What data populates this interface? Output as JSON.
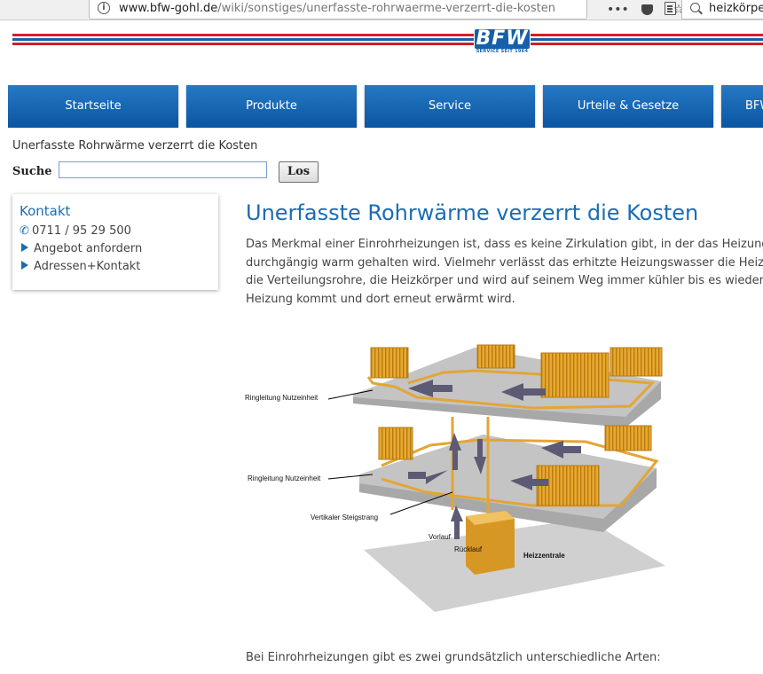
{
  "browser": {
    "url_domain": "www.bfw-gohl.de",
    "url_path": "/wiki/sonstiges/unerfasste-rohrwaerme-verzerrt-die-kosten",
    "search_text": "heizkörper",
    "more_glyph": "•••",
    "bookmark_glyph": "☆"
  },
  "header": {
    "logo_text": "BFW",
    "logo_sub": "SERVICE SEIT 1964",
    "stripe_colors": [
      "#1560ab",
      "#d0202a"
    ]
  },
  "nav": [
    {
      "label": "Startseite"
    },
    {
      "label": "Produkte"
    },
    {
      "label": "Service"
    },
    {
      "label": "Urteile & Gesetze"
    },
    {
      "label": "BFW"
    }
  ],
  "breadcrumb": "Unerfasste Rohrwärme verzerrt die Kosten",
  "search": {
    "label": "Suche",
    "value": "",
    "button_label": "Los"
  },
  "contact": {
    "title": "Kontakt",
    "phone": "0711 / 95 29 500",
    "links": [
      "Angebot anfordern",
      "Adressen+Kontakt"
    ]
  },
  "content": {
    "title": "Unerfasste Rohrwärme verzerrt die Kosten",
    "intro_lines": [
      "Das Merkmal einer Einrohrheizungen ist, dass es keine Zirkulation gibt, in der das Heizung",
      "durchgängig warm gehalten wird. Vielmehr verlässt das erhitzte Heizungswasser die Heiz",
      "die Verteilungsrohre, die Heizkörper und wird auf seinem Weg immer kühler bis es wieder",
      "Heizung kommt und dort erneut erwärmt wird."
    ],
    "bottom_text": "Bei Einrohrheizungen gibt es zwei grundsätzlich unterschiedliche Arten:"
  },
  "diagram": {
    "labels": {
      "ring_top": "Ringleitung Nutzeinheit",
      "ring_middle": "Ringleitung Nutzeinheit",
      "vertical": "Vertikaler Steigstrang",
      "vorlauf": "Vorlauf",
      "ruecklauf": "Rücklauf",
      "central": "Heizzentrale"
    },
    "colors": {
      "radiator": "#e8a92e",
      "pipe": "#e3a536",
      "floor": "#c9c9c9",
      "arrow": "#5c5a74"
    }
  }
}
